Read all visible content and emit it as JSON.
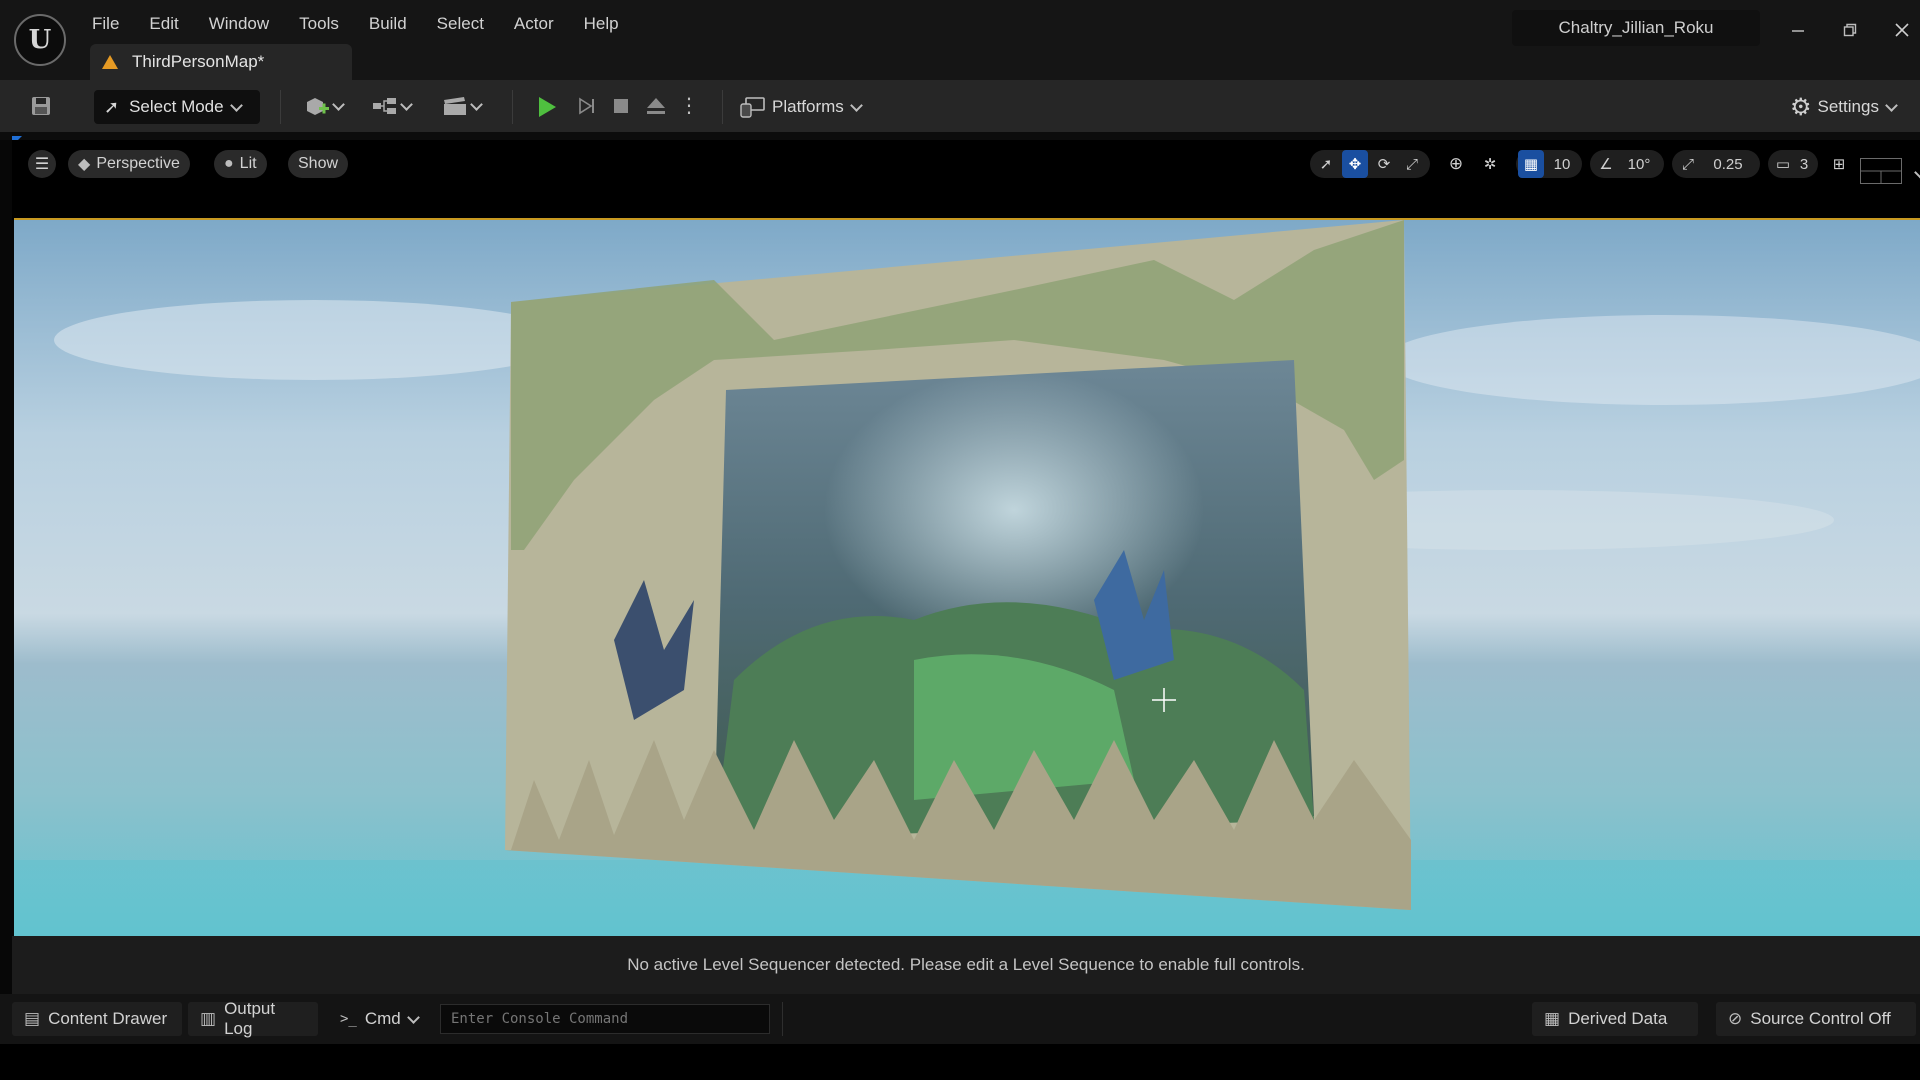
{
  "menu": {
    "items": [
      "File",
      "Edit",
      "Window",
      "Tools",
      "Build",
      "Select",
      "Actor",
      "Help"
    ]
  },
  "document_tab": {
    "label": "ThirdPersonMap*"
  },
  "project_name": "Chaltry_Jillian_Roku",
  "toolbar": {
    "select_mode_label": "Select Mode",
    "platforms_label": "Platforms",
    "settings_label": "Settings"
  },
  "viewport_toolbar": {
    "perspective_label": "Perspective",
    "lit_label": "Lit",
    "show_label": "Show",
    "grid_snap_value": "10",
    "rotation_snap_value": "10°",
    "scale_snap_value": "0.25",
    "camera_speed_value": "3"
  },
  "sequencer_message": "No active Level Sequencer detected. Please edit a Level Sequence to enable full controls.",
  "statusbar": {
    "content_drawer_label": "Content Drawer",
    "output_log_label": "Output Log",
    "cmd_label": "Cmd",
    "console_placeholder": "Enter Console Command",
    "derived_data_label": "Derived Data",
    "source_control_label": "Source Control Off"
  },
  "colors": {
    "accent_blue": "#1a4fa0",
    "play_green": "#4fbf3f",
    "warning_orange": "#e59a24",
    "viewport_border": "#c79a22"
  }
}
